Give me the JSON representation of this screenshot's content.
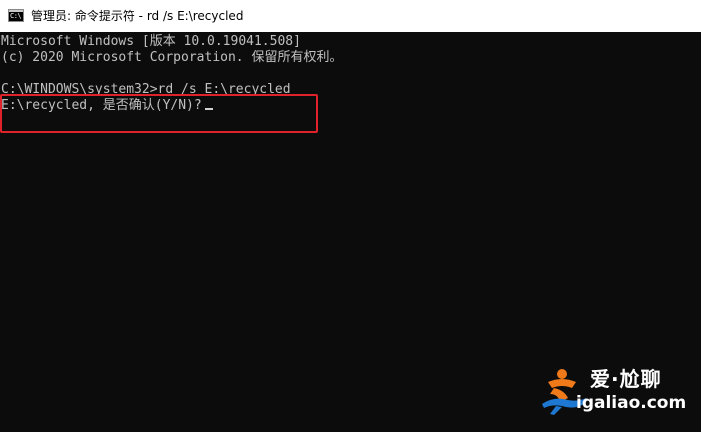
{
  "titlebar": {
    "icon": "cmd-icon",
    "icon_glyph": "C:\\",
    "title": "管理员: 命令提示符 - rd  /s E:\\recycled"
  },
  "console": {
    "lines": [
      "Microsoft Windows [版本 10.0.19041.508]",
      "(c) 2020 Microsoft Corporation. 保留所有权利。",
      "",
      "C:\\WINDOWS\\system32>rd /s E:\\recycled",
      "E:\\recycled, 是否确认(Y/N)?"
    ]
  },
  "annotation": {
    "box_color": "#e0222a"
  },
  "watermark": {
    "brand_cn": "爱·尬聊",
    "url": "igaliao.com",
    "colors": {
      "figure_orange": "#f07a1a",
      "figure_blue": "#1e78d2"
    }
  }
}
